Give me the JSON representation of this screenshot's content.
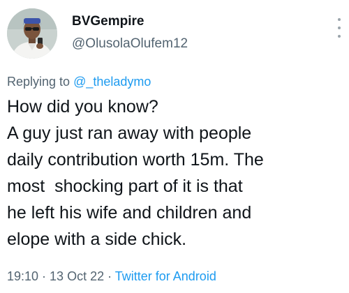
{
  "author": {
    "display_name": "BVGempire",
    "handle": "@OlusolaOlufem12",
    "avatar_icon": "user-photo-avatar"
  },
  "reply": {
    "prefix": "Replying to ",
    "target": "@_theladymo"
  },
  "tweet": {
    "lines": [
      "How did you know?",
      "A guy just ran away with people",
      "daily contribution worth 15m. The",
      "most  shocking part of it is that",
      "he left his wife and children and",
      "elope with a side chick."
    ]
  },
  "meta": {
    "time": "19:10",
    "separator_1": " · ",
    "date": "13 Oct 22",
    "separator_2": " · ",
    "source": "Twitter for Android"
  },
  "icons": {
    "more": "more-options-icon"
  },
  "colors": {
    "text": "#0f1419",
    "secondary": "#536471",
    "link": "#1d9bf0"
  }
}
